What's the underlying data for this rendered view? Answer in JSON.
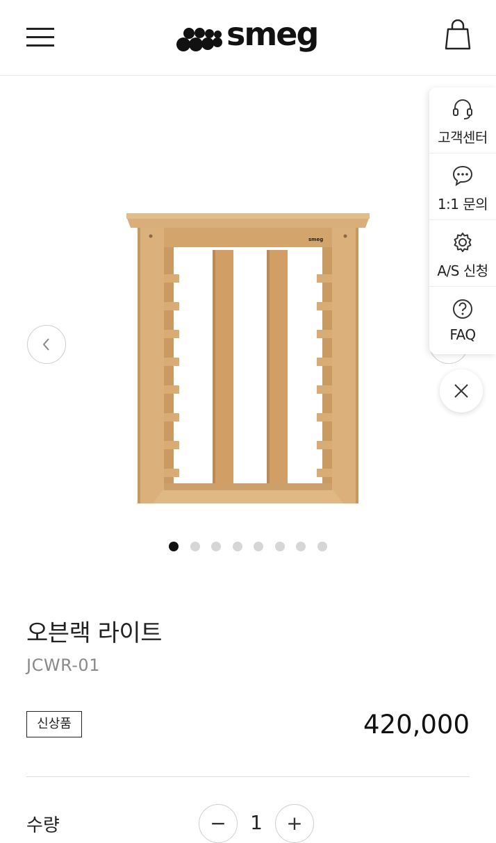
{
  "header": {
    "brand": "smeg",
    "menu_icon": "hamburger-menu-icon",
    "cart_icon": "shopping-bag-icon"
  },
  "gallery": {
    "slide_count": 8,
    "active_index": 0,
    "prev_icon": "chevron-left-icon",
    "next_icon": "chevron-right-icon",
    "mini_brand": "smeg"
  },
  "side_panel": {
    "items": [
      {
        "label": "고객센터",
        "icon": "headset-icon"
      },
      {
        "label": "1:1 문의",
        "icon": "chat-bubble-icon"
      },
      {
        "label": "A/S 신청",
        "icon": "gear-icon"
      },
      {
        "label": "FAQ",
        "icon": "question-circle-icon"
      }
    ],
    "close_icon": "close-icon"
  },
  "product": {
    "name": "오븐랙 라이트",
    "code": "JCWR-01",
    "badge": "신상품",
    "price": "420,000"
  },
  "quantity": {
    "label": "수량",
    "value": "1",
    "minus": "−",
    "plus": "+"
  },
  "colors": {
    "wood": "#d9ad77",
    "wood_dark": "#b98a55",
    "text": "#222222",
    "muted": "#8a8a8a"
  }
}
